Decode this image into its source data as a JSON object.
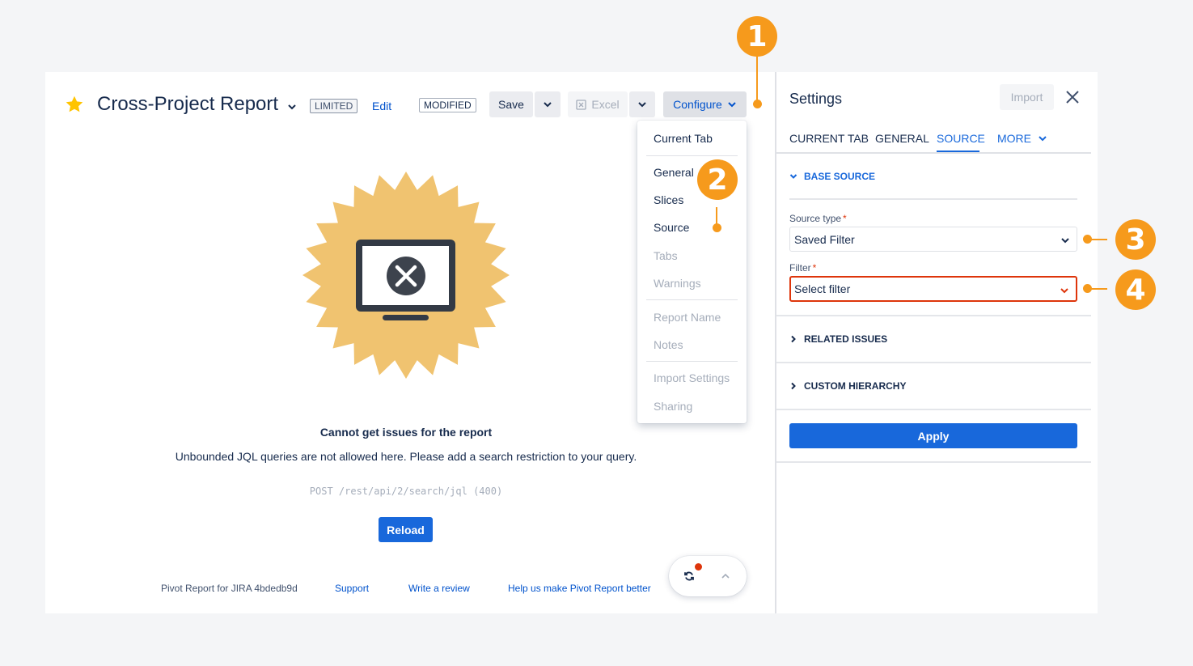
{
  "header": {
    "title": "Cross-Project Report",
    "limited_badge": "LIMITED",
    "edit_label": "Edit",
    "modified_badge": "MODIFIED",
    "save_label": "Save",
    "excel_label": "Excel",
    "configure_label": "Configure"
  },
  "configure_menu": {
    "items": [
      {
        "label": "Current Tab",
        "enabled": true
      },
      {
        "label": "General",
        "enabled": true
      },
      {
        "label": "Slices",
        "enabled": true
      },
      {
        "label": "Source",
        "enabled": true
      },
      {
        "label": "Tabs",
        "enabled": false
      },
      {
        "label": "Warnings",
        "enabled": false
      },
      {
        "label": "Report Name",
        "enabled": false
      },
      {
        "label": "Notes",
        "enabled": false
      },
      {
        "label": "Import Settings",
        "enabled": false
      },
      {
        "label": "Sharing",
        "enabled": false
      }
    ]
  },
  "error": {
    "title": "Cannot get issues for the report",
    "message": "Unbounded JQL queries are not allowed here. Please add a search restriction to your query.",
    "code": "POST /rest/api/2/search/jql (400)",
    "reload_label": "Reload"
  },
  "footer": {
    "brand": "Pivot Report for JIRA 4bdedb9d",
    "support": "Support",
    "review": "Write a review",
    "help": "Help us make Pivot Report better"
  },
  "callouts": [
    "1",
    "2",
    "3",
    "4"
  ],
  "settings": {
    "title": "Settings",
    "import_label": "Import",
    "tabs": [
      {
        "label": "CURRENT TAB",
        "active": false
      },
      {
        "label": "GENERAL",
        "active": false
      },
      {
        "label": "SOURCE",
        "active": true
      },
      {
        "label": "MORE",
        "active": false
      }
    ],
    "base_source": "BASE SOURCE",
    "source_type_label": "Source type",
    "source_type_value": "Saved Filter",
    "filter_label": "Filter",
    "filter_placeholder": "Select filter",
    "required_mark": "*",
    "related_issues": "RELATED ISSUES",
    "custom_hierarchy": "CUSTOM HIERARCHY",
    "apply_label": "Apply"
  },
  "colors": {
    "accent": "#1868db",
    "callout": "#f69a1c",
    "error": "#de350b",
    "badge": "#f0c370"
  }
}
